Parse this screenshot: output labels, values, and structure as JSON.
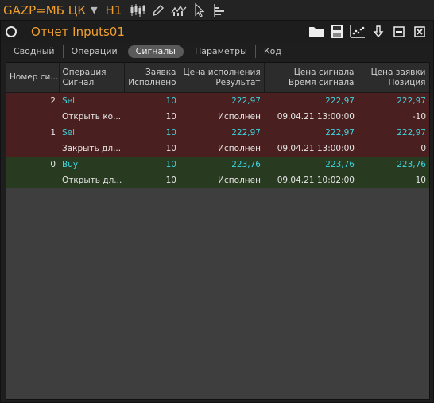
{
  "toolbar": {
    "symbol": "GAZP=МБ ЦК",
    "timeframe": "H1",
    "icons": [
      "candles-icon",
      "pencil-icon",
      "indicator-icon",
      "cursor-icon",
      "depth-icon"
    ]
  },
  "window": {
    "title": "Отчет Inputs01",
    "actions": [
      "folder-icon",
      "save-icon",
      "chart-settings-icon",
      "download-arrow-icon",
      "minimize-icon",
      "close-icon"
    ]
  },
  "tabs": [
    {
      "label": "Сводный",
      "active": false
    },
    {
      "label": "Операции",
      "active": false
    },
    {
      "label": "Сигналы",
      "active": true
    },
    {
      "label": "Параметры",
      "active": false
    },
    {
      "label": "Код",
      "active": false
    }
  ],
  "table": {
    "columns": [
      {
        "line1": "Номер си...",
        "line2": ""
      },
      {
        "line1": "Операция",
        "line2": "Сигнал"
      },
      {
        "line1": "Заявка",
        "line2": "Исполнено"
      },
      {
        "line1": "Цена исполнения",
        "line2": "Результат"
      },
      {
        "line1": "Цена сигнала",
        "line2": "Время сигнала"
      },
      {
        "line1": "Цена заявки",
        "line2": "Позиция"
      }
    ],
    "rows": [
      {
        "kind": "sell",
        "num": "2",
        "op": "Sell",
        "order": "10",
        "exec_price": "222,97",
        "sig_price": "222,97",
        "order_price": "222,97"
      },
      {
        "kind": "sell",
        "num": "",
        "op": "Открыть ко...",
        "order": "10",
        "exec_price": "Исполнен",
        "sig_price": "09.04.21 13:00:00",
        "order_price": "-10"
      },
      {
        "kind": "sell",
        "num": "1",
        "op": "Sell",
        "order": "10",
        "exec_price": "222,97",
        "sig_price": "222,97",
        "order_price": "222,97"
      },
      {
        "kind": "sell",
        "num": "",
        "op": "Закрыть дл...",
        "order": "10",
        "exec_price": "Исполнен",
        "sig_price": "09.04.21 13:00:00",
        "order_price": "0"
      },
      {
        "kind": "buy",
        "num": "0",
        "op": "Buy",
        "order": "10",
        "exec_price": "223,76",
        "sig_price": "223,76",
        "order_price": "223,76"
      },
      {
        "kind": "buy",
        "num": "",
        "op": "Открыть дл...",
        "order": "10",
        "exec_price": "Исполнен",
        "sig_price": "09.04.21 10:02:00",
        "order_price": "10"
      }
    ]
  },
  "colors": {
    "accent": "#f0a030",
    "cyan_value": "#3cd4e0",
    "sell_row": "#4a1f1f",
    "buy_row": "#283a20"
  }
}
